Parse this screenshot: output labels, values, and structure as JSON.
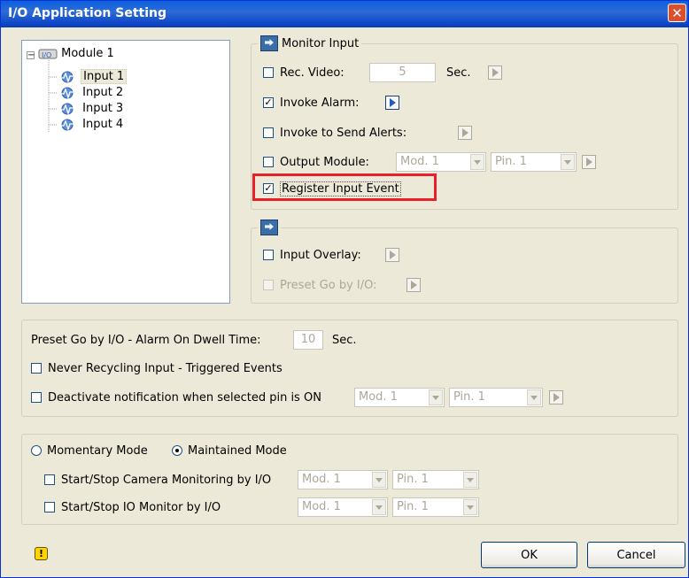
{
  "window": {
    "title": "I/O Application Setting",
    "close_glyph": "✕"
  },
  "tree": {
    "root": {
      "label": "Module 1",
      "expander": "−"
    },
    "items": [
      {
        "label": "Input 1",
        "selected": true
      },
      {
        "label": "Input 2"
      },
      {
        "label": "Input 3"
      },
      {
        "label": "Input 4"
      }
    ]
  },
  "monitor_input": {
    "caption": "Monitor Input",
    "rec_video": {
      "label": "Rec. Video:",
      "value": "5",
      "unit": "Sec.",
      "checked": false
    },
    "invoke_alarm": {
      "label": "Invoke Alarm:",
      "checked": true
    },
    "invoke_alerts": {
      "label": "Invoke to Send Alerts:",
      "checked": false
    },
    "output_module": {
      "label": "Output Module:",
      "module": "Mod. 1",
      "pin": "Pin. 1",
      "checked": false
    },
    "register_event": {
      "label": "Register Input Event",
      "checked": true
    }
  },
  "overlay_group": {
    "input_overlay": {
      "label": "Input Overlay:",
      "checked": false
    },
    "preset_go": {
      "label": "Preset Go by I/O:",
      "checked": false
    }
  },
  "options": {
    "dwell_label": "Preset Go by I/O - Alarm On Dwell Time:",
    "dwell_value": "10",
    "dwell_unit": "Sec.",
    "never_recycling": "Never Recycling Input - Triggered Events",
    "deactivate": {
      "label": "Deactivate notification when selected pin is ON",
      "module": "Mod. 1",
      "pin": "Pin. 1"
    }
  },
  "mode": {
    "momentary": "Momentary Mode",
    "maintained": "Maintained Mode",
    "selected": "maintained",
    "camera_monitoring": {
      "label": "Start/Stop Camera Monitoring by I/O",
      "module": "Mod. 1",
      "pin": "Pin. 1"
    },
    "io_monitor": {
      "label": "Start/Stop IO Monitor by I/O",
      "module": "Mod. 1",
      "pin": "Pin. 1"
    }
  },
  "buttons": {
    "ok": "OK",
    "cancel": "Cancel"
  },
  "check_glyph": "✓",
  "warn_glyph": "!",
  "colors": {
    "title_bar": "#0a5fde",
    "dialog_bg": "#ece9d8",
    "highlight": "#e8202a"
  }
}
